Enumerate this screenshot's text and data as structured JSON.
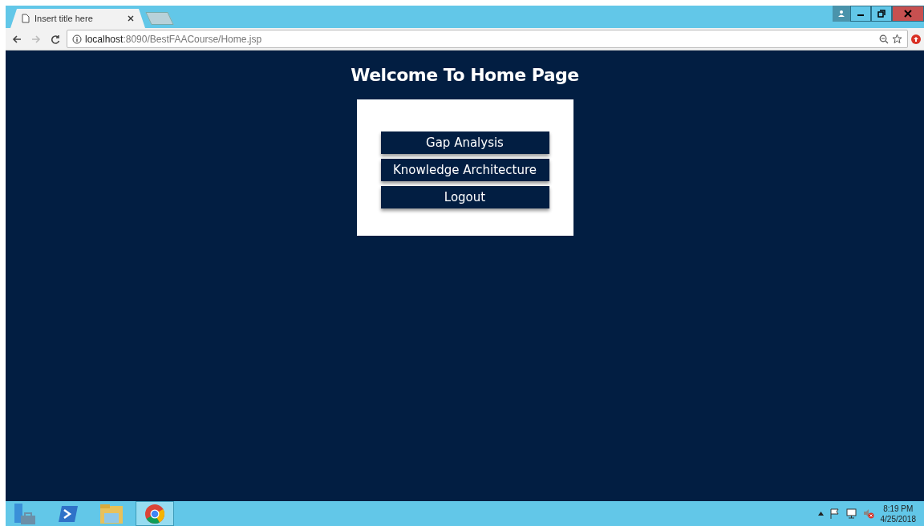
{
  "browser": {
    "tabs": [
      {
        "title": "Insert title here",
        "selected": true
      }
    ],
    "address": {
      "host": "localhost",
      "rest": ":8090/BestFAACourse/Home.jsp"
    }
  },
  "page": {
    "heading": "Welcome To Home Page",
    "buttons": [
      "Gap Analysis",
      "Knowledge Architecture",
      "Logout"
    ]
  },
  "taskbar": {
    "apps": [
      {
        "kind": "server",
        "selected": false
      },
      {
        "kind": "shell",
        "selected": false
      },
      {
        "kind": "folder",
        "selected": false
      },
      {
        "kind": "browser",
        "selected": true
      }
    ],
    "time": "8:19 PM",
    "date": "4/25/2018"
  }
}
